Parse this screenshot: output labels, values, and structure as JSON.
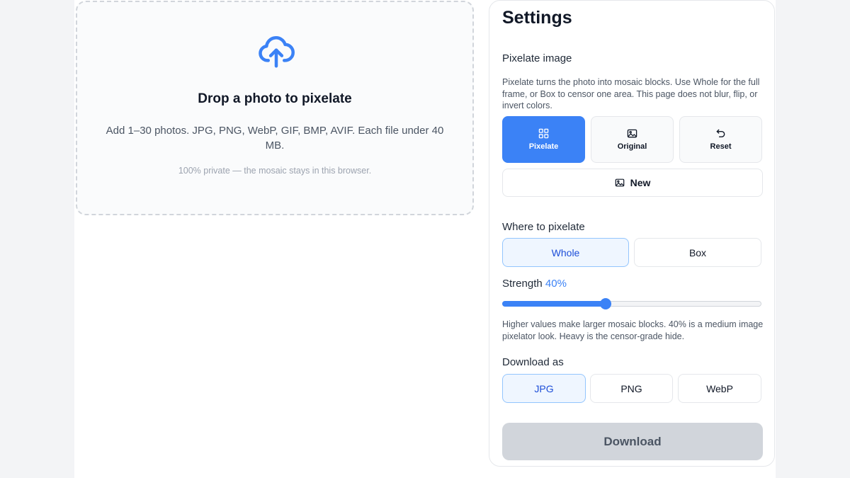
{
  "dropzone": {
    "title": "Drop a photo to pixelate",
    "description": "Add 1–30 photos. JPG, PNG, WebP, GIF, BMP, AVIF. Each file under 40 MB.",
    "privacy": "100% private — the mosaic stays in this browser.",
    "icon": "cloud-upload-icon"
  },
  "settings": {
    "title": "Settings",
    "mode_label": "Pixelate image",
    "mode_help": "Pixelate turns the photo into mosaic blocks. Use Whole for the full frame, or Box to censor one area. This page does not blur, flip, or invert colors.",
    "actions": [
      {
        "label": "Pixelate",
        "icon": "grid-icon",
        "active": true
      },
      {
        "label": "Original",
        "icon": "image-icon",
        "active": false
      },
      {
        "label": "Reset",
        "icon": "undo-icon",
        "active": false
      }
    ],
    "new_label": "New",
    "where_label": "Where to pixelate",
    "where_options": [
      {
        "label": "Whole",
        "selected": true
      },
      {
        "label": "Box",
        "selected": false
      }
    ],
    "strength_label": "Strength",
    "strength_display": "40%",
    "strength_value": 0.4,
    "strength_help": "Higher values make larger mosaic blocks. 40% is a medium image pixelator look. Heavy is the censor-grade hide.",
    "download_as_label": "Download as",
    "formats": [
      {
        "label": "JPG",
        "selected": true
      },
      {
        "label": "PNG",
        "selected": false
      },
      {
        "label": "WebP",
        "selected": false
      }
    ],
    "download_label": "Download",
    "download_enabled": false
  },
  "colors": {
    "accent": "#3b82f6",
    "selected_bg": "#eff6ff",
    "disabled_bg": "#d1d5db"
  }
}
